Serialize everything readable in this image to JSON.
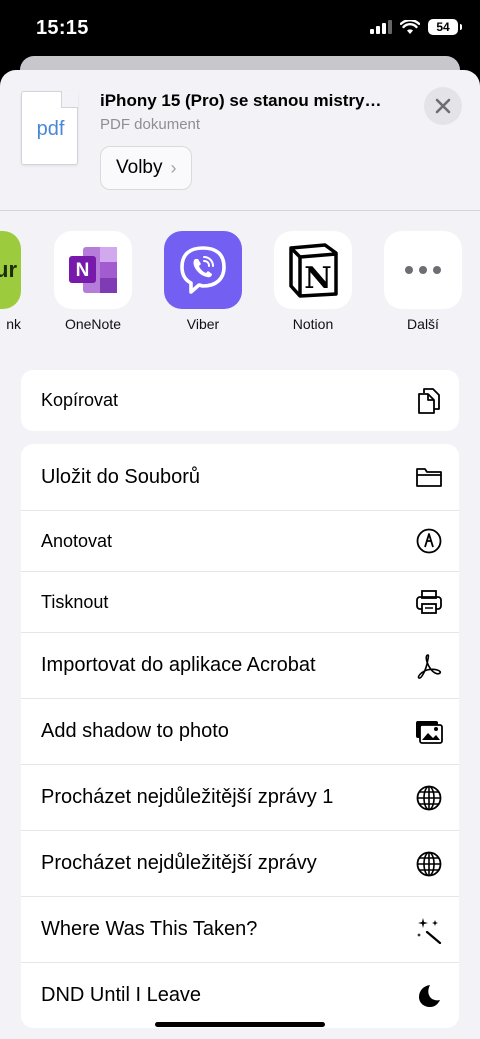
{
  "status": {
    "time": "15:15",
    "battery": "54"
  },
  "share": {
    "thumbnail_label": "pdf",
    "title": "iPhony 15 (Pro) se stanou mistry…",
    "subtitle": "PDF dokument",
    "options_label": "Volby"
  },
  "apps": [
    {
      "label": "nk",
      "icon": "partial-app-icon",
      "icon_text": "ur"
    },
    {
      "label": "OneNote",
      "icon": "onenote-icon"
    },
    {
      "label": "Viber",
      "icon": "viber-icon"
    },
    {
      "label": "Notion",
      "icon": "notion-icon"
    },
    {
      "label": "Další",
      "icon": "more-icon"
    }
  ],
  "actions_top": [
    {
      "label": "Kopírovat",
      "icon": "copy-icon"
    }
  ],
  "actions": [
    {
      "label": "Uložit do Souborů",
      "icon": "folder-icon"
    },
    {
      "label": "Anotovat",
      "icon": "markup-icon"
    },
    {
      "label": "Tisknout",
      "icon": "printer-icon"
    },
    {
      "label": "Importovat do aplikace Acrobat",
      "icon": "acrobat-icon"
    },
    {
      "label": "Add shadow to photo",
      "icon": "photos-icon"
    },
    {
      "label": "Procházet nejdůležitější zprávy 1",
      "icon": "globe-icon"
    },
    {
      "label": "Procházet nejdůležitější zprávy",
      "icon": "globe-icon"
    },
    {
      "label": "Where Was This Taken?",
      "icon": "sparkles-icon"
    },
    {
      "label": "DND Until I Leave",
      "icon": "moon-icon"
    }
  ]
}
